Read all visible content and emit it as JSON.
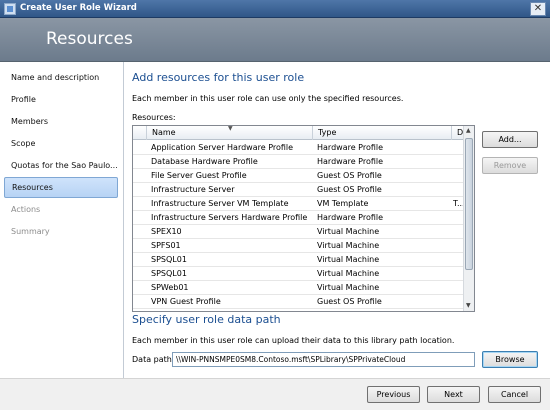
{
  "window": {
    "title": "Create User Role Wizard",
    "close_glyph": "✕"
  },
  "banner": {
    "heading": "Resources"
  },
  "nav": {
    "items": [
      {
        "label": "Name and description"
      },
      {
        "label": "Profile"
      },
      {
        "label": "Members"
      },
      {
        "label": "Scope"
      },
      {
        "label": "Quotas for the Sao Paulo..."
      },
      {
        "label": "Resources"
      },
      {
        "label": "Actions"
      },
      {
        "label": "Summary"
      }
    ],
    "selected": "Resources"
  },
  "resources": {
    "heading": "Add resources for this user role",
    "description": "Each member in this user role can use only the specified resources.",
    "list_label": "Resources:",
    "columns": [
      "Name",
      "Type",
      "D"
    ],
    "rows": [
      {
        "name": "Application Server Hardware Profile",
        "type": "Hardware Profile",
        "d": ""
      },
      {
        "name": "Database Hardware Profile",
        "type": "Hardware Profile",
        "d": ""
      },
      {
        "name": "File Server Guest Profile",
        "type": "Guest OS Profile",
        "d": ""
      },
      {
        "name": "Infrastructure Server",
        "type": "Guest OS Profile",
        "d": ""
      },
      {
        "name": "Infrastructure Server VM Template",
        "type": "VM Template",
        "d": "T..."
      },
      {
        "name": "Infrastructure Servers Hardware Profile",
        "type": "Hardware Profile",
        "d": ""
      },
      {
        "name": "SPEX10",
        "type": "Virtual Machine",
        "d": ""
      },
      {
        "name": "SPFS01",
        "type": "Virtual Machine",
        "d": ""
      },
      {
        "name": "SPSQL01",
        "type": "Virtual Machine",
        "d": ""
      },
      {
        "name": "SPSQL01",
        "type": "Virtual Machine",
        "d": ""
      },
      {
        "name": "SPWeb01",
        "type": "Virtual Machine",
        "d": ""
      },
      {
        "name": "VPN Guest Profile",
        "type": "Guest OS Profile",
        "d": ""
      }
    ],
    "add_label": "Add...",
    "remove_label": "Remove"
  },
  "path": {
    "heading": "Specify user role data path",
    "description": "Each member in this user role can upload their data to this library path location.",
    "label": "Data path:",
    "value": "\\\\WIN-PNNSMPE0SM8.Contoso.msft\\SPLibrary\\SPPrivateCloud",
    "browse_label": "Browse"
  },
  "footer": {
    "previous_label": "Previous",
    "next_label": "Next",
    "cancel_label": "Cancel"
  }
}
